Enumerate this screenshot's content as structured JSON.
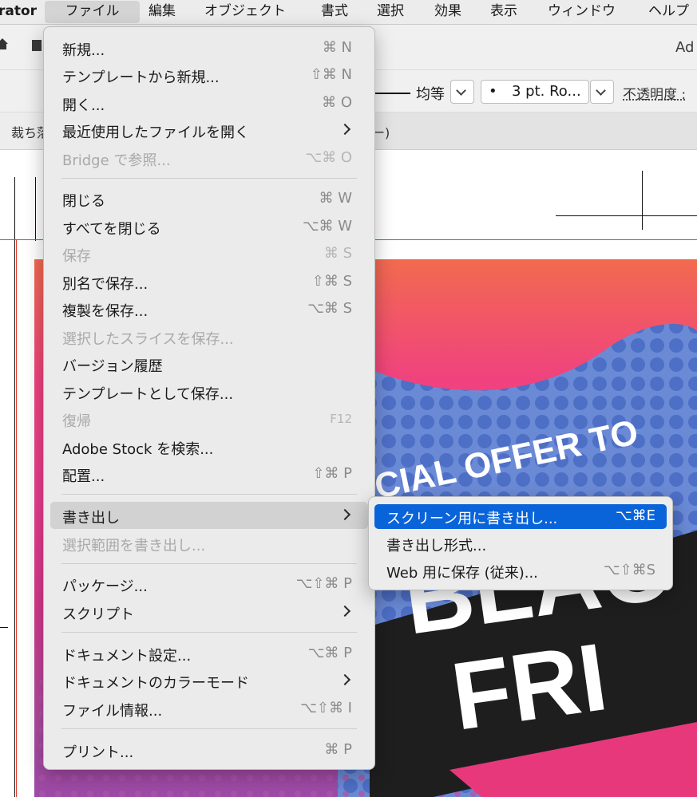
{
  "menubar": {
    "app_name": "rator",
    "items": [
      "ファイル",
      "編集",
      "オブジェクト",
      "書式",
      "選択",
      "効果",
      "表示",
      "ウィンドウ",
      "ヘルプ"
    ]
  },
  "toolbar": {
    "app_short": "Ad",
    "stroke_profile": "均等",
    "brush_dot": "•",
    "brush_name": "3 pt. Ro...",
    "opacity_label": "不透明度 :"
  },
  "tab": {
    "title": "裁ち落",
    "tail": "ー)"
  },
  "artwork": {
    "offer_text": "CIAL OFFER TO",
    "headline_top": "BLAC",
    "headline_bottom": "FRI",
    "colors": {
      "top": "#f26a4f",
      "pink": "#f0437e",
      "purple": "#9c4aa8",
      "wave_blue": "#5b7fd0",
      "banner": "#1e1e1e"
    }
  },
  "file_menu": {
    "items": [
      {
        "label": "新規...",
        "shortcut": "⌘ N",
        "enabled": true
      },
      {
        "label": "テンプレートから新規...",
        "shortcut": "⇧⌘ N",
        "enabled": true
      },
      {
        "label": "開く...",
        "shortcut": "⌘ O",
        "enabled": true
      },
      {
        "label": "最近使用したファイルを開く",
        "shortcut": "",
        "enabled": true,
        "submenu": true
      },
      {
        "label": "Bridge で参照...",
        "shortcut": "⌥⌘ O",
        "enabled": false
      },
      {
        "label": "閉じる",
        "shortcut": "⌘ W",
        "enabled": true
      },
      {
        "label": "すべてを閉じる",
        "shortcut": "⌥⌘ W",
        "enabled": true
      },
      {
        "label": "保存",
        "shortcut": "⌘ S",
        "enabled": false
      },
      {
        "label": "別名で保存...",
        "shortcut": "⇧⌘ S",
        "enabled": true
      },
      {
        "label": "複製を保存...",
        "shortcut": "⌥⌘ S",
        "enabled": true
      },
      {
        "label": "選択したスライスを保存...",
        "shortcut": "",
        "enabled": false
      },
      {
        "label": "バージョン履歴",
        "shortcut": "",
        "enabled": true
      },
      {
        "label": "テンプレートとして保存...",
        "shortcut": "",
        "enabled": true
      },
      {
        "label": "復帰",
        "shortcut": "F12",
        "enabled": false
      },
      {
        "label": "Adobe Stock を検索...",
        "shortcut": "",
        "enabled": true
      },
      {
        "label": "配置...",
        "shortcut": "⇧⌘ P",
        "enabled": true
      },
      {
        "label": "書き出し",
        "shortcut": "",
        "enabled": true,
        "submenu": true,
        "highlighted": true
      },
      {
        "label": "選択範囲を書き出し...",
        "shortcut": "",
        "enabled": false
      },
      {
        "label": "パッケージ...",
        "shortcut": "⌥⇧⌘ P",
        "enabled": true
      },
      {
        "label": "スクリプト",
        "shortcut": "",
        "enabled": true,
        "submenu": true
      },
      {
        "label": "ドキュメント設定...",
        "shortcut": "⌥⌘ P",
        "enabled": true
      },
      {
        "label": "ドキュメントのカラーモード",
        "shortcut": "",
        "enabled": true,
        "submenu": true
      },
      {
        "label": "ファイル情報...",
        "shortcut": "⌥⇧⌘ I",
        "enabled": true
      },
      {
        "label": "プリント...",
        "shortcut": "⌘ P",
        "enabled": true
      }
    ]
  },
  "export_submenu": {
    "items": [
      {
        "label": "スクリーン用に書き出し...",
        "shortcut": "⌥⌘E",
        "selected": true
      },
      {
        "label": "書き出し形式...",
        "shortcut": "",
        "selected": false
      },
      {
        "label": "Web 用に保存 (従来)...",
        "shortcut": "⌥⇧⌘S",
        "selected": false
      }
    ]
  }
}
